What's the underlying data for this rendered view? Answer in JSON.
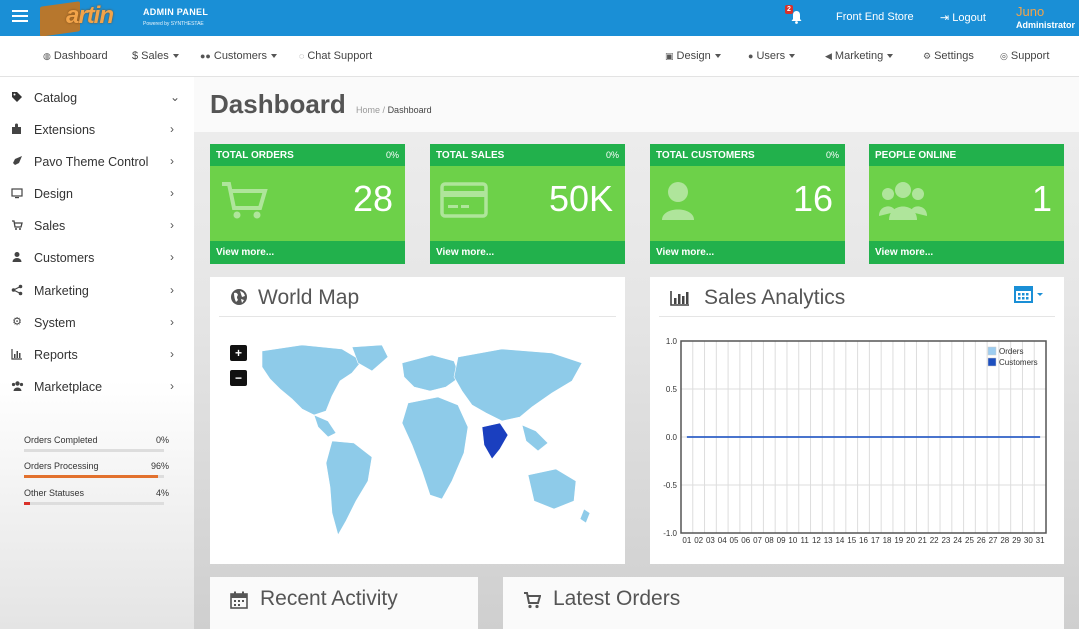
{
  "header": {
    "logo_text": "artin",
    "admin_label": "ADMIN PANEL",
    "powered_by": "Powered by SYNTHESTAE",
    "notifications_count": "2",
    "front_store": "Front End Store",
    "logout": "Logout",
    "user_name": "Juno",
    "user_role": "Administrator",
    "accent_color": "#1a8fd6"
  },
  "nav": {
    "dashboard": "Dashboard",
    "sales": "$ Sales",
    "customers": "Customers",
    "chat_support": "Chat Support",
    "design": "Design",
    "users": "Users",
    "marketing": "Marketing",
    "settings": "Settings",
    "support": "Support"
  },
  "sidebar": {
    "items": [
      {
        "label": "Catalog",
        "icon": "tags-icon"
      },
      {
        "label": "Extensions",
        "icon": "puzzle-icon"
      },
      {
        "label": "Pavo Theme Control",
        "icon": "rocket-icon"
      },
      {
        "label": "Design",
        "icon": "desktop-icon"
      },
      {
        "label": "Sales",
        "icon": "cart-icon"
      },
      {
        "label": "Customers",
        "icon": "user-icon"
      },
      {
        "label": "Marketing",
        "icon": "share-icon"
      },
      {
        "label": "System",
        "icon": "gear-icon"
      },
      {
        "label": "Reports",
        "icon": "bar-chart-icon"
      },
      {
        "label": "Marketplace",
        "icon": "users-icon"
      }
    ],
    "stats": [
      {
        "label": "Orders Completed",
        "value": "0%",
        "fraction": 0
      },
      {
        "label": "Orders Processing",
        "value": "96%",
        "fraction": 0.96
      },
      {
        "label": "Other Statuses",
        "value": "4%",
        "fraction": 0.04
      }
    ]
  },
  "page": {
    "title": "Dashboard",
    "breadcrumb_home": "Home",
    "breadcrumb_sep": "/",
    "breadcrumb_current": "Dashboard"
  },
  "tiles": [
    {
      "title": "TOTAL ORDERS",
      "pct": "0%",
      "value": "28",
      "more": "View more...",
      "icon": "cart-icon"
    },
    {
      "title": "TOTAL SALES",
      "pct": "0%",
      "value": "50K",
      "more": "View more...",
      "icon": "credit-card-icon"
    },
    {
      "title": "TOTAL CUSTOMERS",
      "pct": "0%",
      "value": "16",
      "more": "View more...",
      "icon": "user-icon"
    },
    {
      "title": "PEOPLE ONLINE",
      "pct": "",
      "value": "1",
      "more": "View more...",
      "icon": "users-icon"
    }
  ],
  "world_map": {
    "title": "World Map",
    "zoom_in": "+",
    "zoom_out": "−",
    "land_color": "#8ecbe9",
    "highlight_color": "#1a3fbf"
  },
  "sales_analytics": {
    "title": "Sales Analytics"
  },
  "chart_data": {
    "type": "line",
    "x": [
      "01",
      "02",
      "03",
      "04",
      "05",
      "06",
      "07",
      "08",
      "09",
      "10",
      "11",
      "12",
      "13",
      "14",
      "15",
      "16",
      "17",
      "18",
      "19",
      "20",
      "21",
      "22",
      "23",
      "24",
      "25",
      "26",
      "27",
      "28",
      "29",
      "30",
      "31"
    ],
    "series": [
      {
        "name": "Orders",
        "values": [
          0,
          0,
          0,
          0,
          0,
          0,
          0,
          0,
          0,
          0,
          0,
          0,
          0,
          0,
          0,
          0,
          0,
          0,
          0,
          0,
          0,
          0,
          0,
          0,
          0,
          0,
          0,
          0,
          0,
          0,
          0
        ],
        "color": "#9dcdf0"
      },
      {
        "name": "Customers",
        "values": [
          0,
          0,
          0,
          0,
          0,
          0,
          0,
          0,
          0,
          0,
          0,
          0,
          0,
          0,
          0,
          0,
          0,
          0,
          0,
          0,
          0,
          0,
          0,
          0,
          0,
          0,
          0,
          0,
          0,
          0,
          0
        ],
        "color": "#1d4fbf"
      }
    ],
    "ylim": [
      -1.0,
      1.0
    ],
    "yticks": [
      "1.0",
      "0.5",
      "0.0",
      "-0.5",
      "-1.0"
    ],
    "grid": true,
    "legend": "top-right"
  },
  "bottom": {
    "recent_activity": "Recent Activity",
    "latest_orders": "Latest Orders"
  }
}
